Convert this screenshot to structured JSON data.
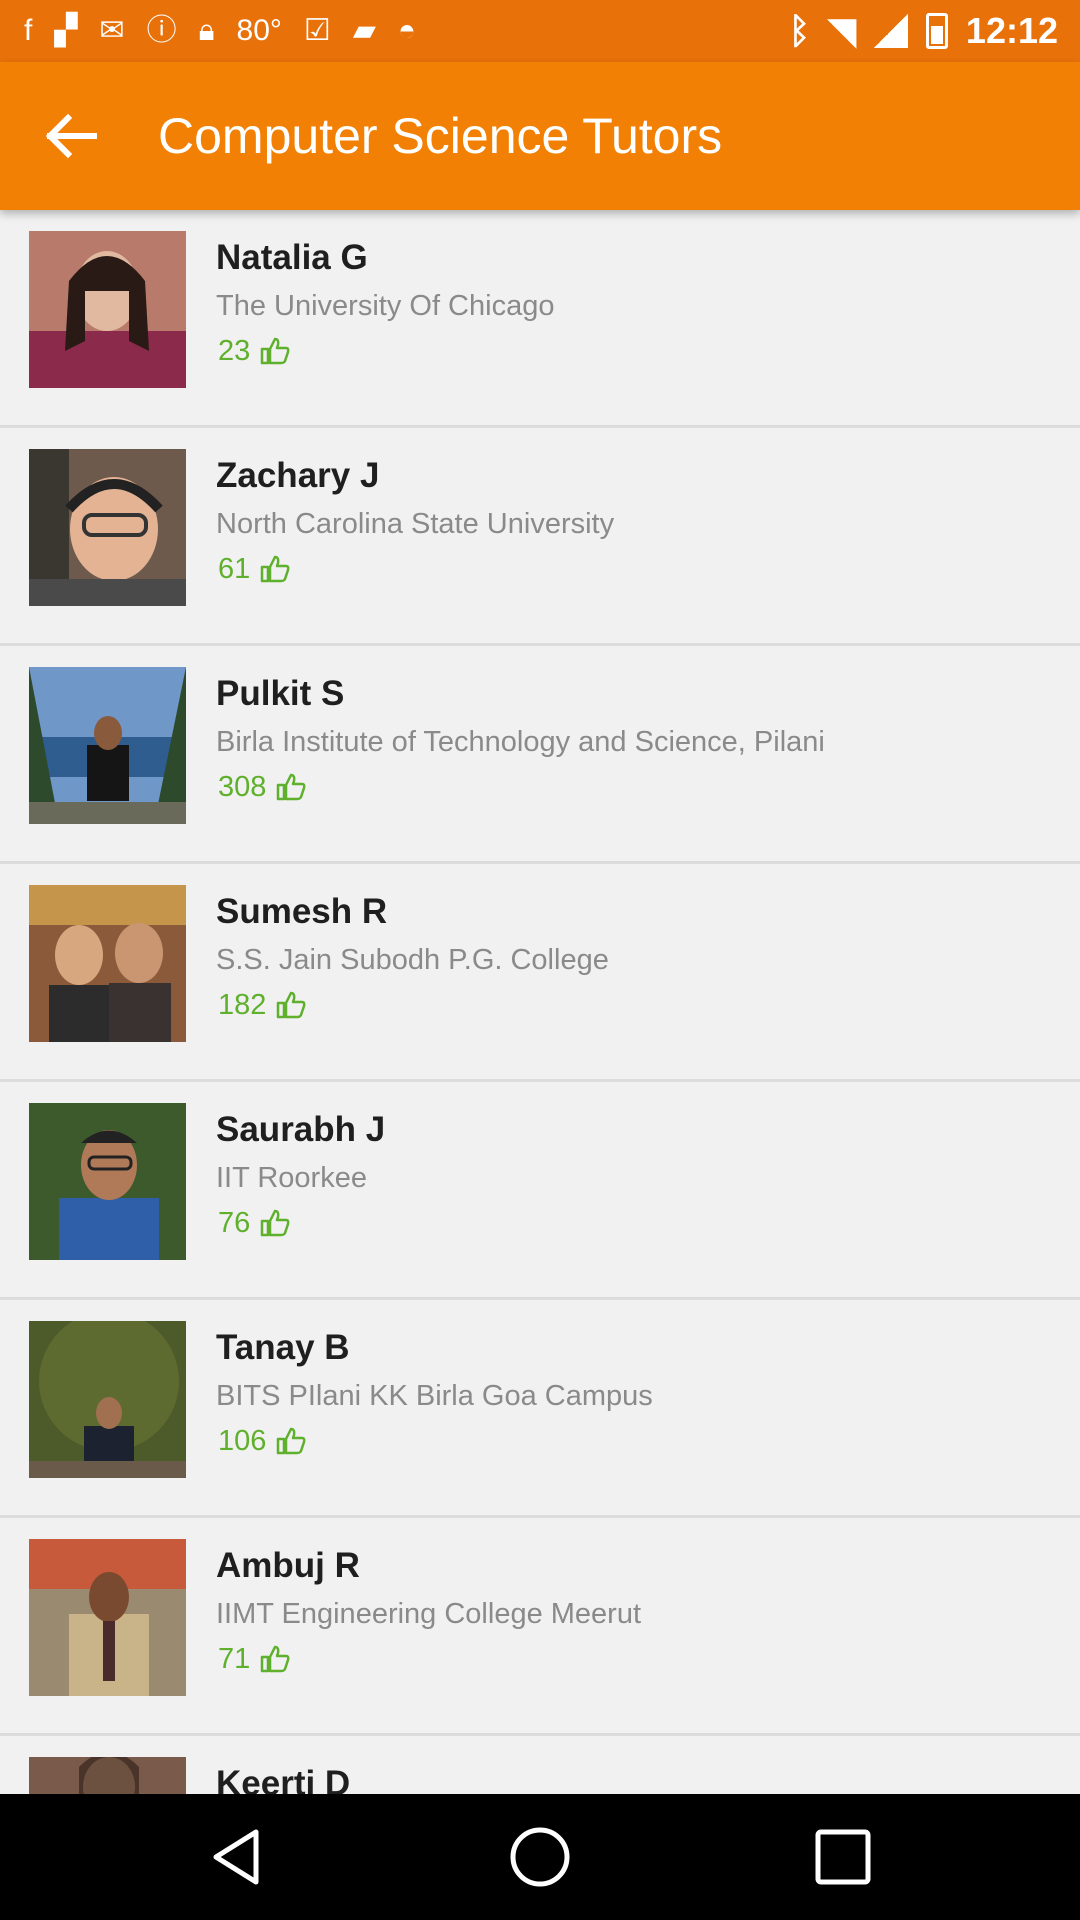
{
  "status_bar": {
    "time": "12:12",
    "temperature": "80°",
    "icons": [
      "facebook-icon",
      "flipboard-icon",
      "gmail-icon",
      "alert-icon",
      "lock-icon",
      "weather-icon",
      "inbox-icon",
      "briefcase-icon",
      "android-icon",
      "bluetooth-icon",
      "wifi-icon",
      "signal-icon",
      "battery-icon"
    ]
  },
  "app_bar": {
    "title": "Computer Science Tutors",
    "back_icon": "arrow-back-icon",
    "color": "#f28004"
  },
  "tutors": [
    {
      "name": "Natalia G",
      "school": "The University Of Chicago",
      "likes": "23"
    },
    {
      "name": "Zachary J",
      "school": "North Carolina State University",
      "likes": "61"
    },
    {
      "name": "Pulkit S",
      "school": "Birla Institute of Technology and Science, Pilani",
      "likes": "308"
    },
    {
      "name": "Sumesh R",
      "school": "S.S. Jain Subodh P.G. College",
      "likes": "182"
    },
    {
      "name": "Saurabh J",
      "school": "IIT Roorkee",
      "likes": "76"
    },
    {
      "name": "Tanay B",
      "school": "BITS PIlani KK Birla Goa Campus",
      "likes": "106"
    },
    {
      "name": "Ambuj R",
      "school": "IIMT Engineering College Meerut",
      "likes": "71"
    },
    {
      "name": "Keerti D",
      "school": "",
      "likes": ""
    }
  ],
  "likes_color": "#5fb02d",
  "nav_bar": {
    "buttons": [
      "back-triangle-icon",
      "home-circle-icon",
      "recents-square-icon"
    ]
  }
}
